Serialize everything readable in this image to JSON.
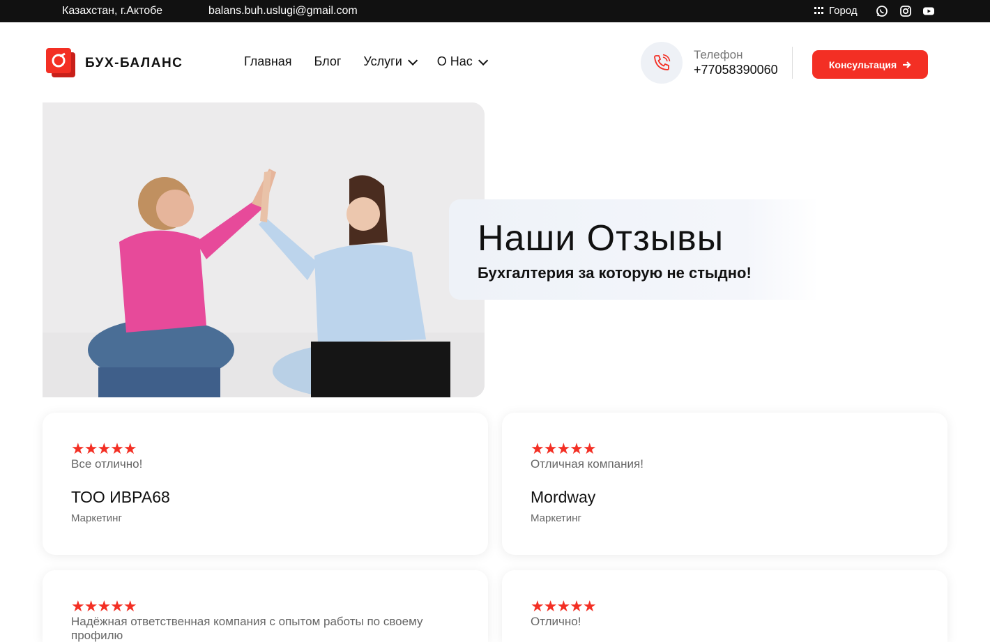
{
  "topbar": {
    "location": "Казахстан, г.Актобе",
    "email": "balans.buh.uslugi@gmail.com",
    "city_label": "Город"
  },
  "header": {
    "logo_text": "БУХ-БАЛАНС",
    "nav": [
      {
        "label": "Главная"
      },
      {
        "label": "Блог"
      },
      {
        "label": "Услуги"
      },
      {
        "label": "О Нас"
      }
    ],
    "phone_label": "Телефон",
    "phone_number": "+77058390060",
    "cta_label": "Консультация"
  },
  "hero": {
    "title": "Наши Отзывы",
    "subtitle": "Бухгалтерия за которую не стыдно!"
  },
  "reviews": [
    {
      "stars": "★★★★★",
      "rating": 5,
      "text": "Все отлично!",
      "author": "ТОО ИВРА68",
      "role": "Маркетинг"
    },
    {
      "stars": "★★★★★",
      "rating": 5,
      "text": "Отличная компания!",
      "author": "Mordway",
      "role": "Маркетинг"
    },
    {
      "stars": "★★★★★",
      "rating": 5,
      "text": "Надёжная ответственная компания с опытом работы по своему профилю",
      "author": "",
      "role": ""
    },
    {
      "stars": "★★★★★",
      "rating": 5,
      "text": "Отлично!",
      "author": "",
      "role": ""
    }
  ],
  "colors": {
    "accent": "#f32f24",
    "topbar": "#111111"
  }
}
